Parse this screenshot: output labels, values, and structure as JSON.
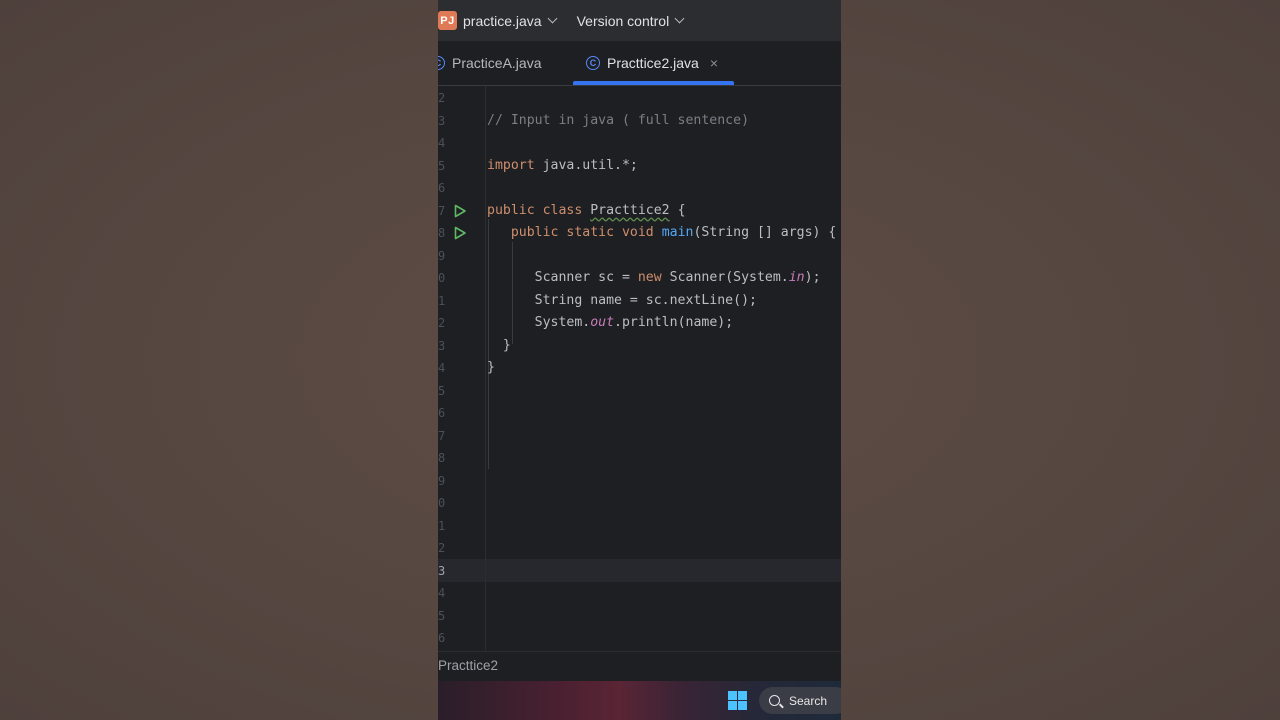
{
  "titlebar": {
    "project_badge": "PJ",
    "project_name": "practice.java",
    "vcs_label": "Version control"
  },
  "tabs": [
    {
      "icon": "C",
      "label": "PracticeA.java",
      "active": false
    },
    {
      "icon": "C",
      "label": "Practtice2.java",
      "active": true,
      "close": "×"
    }
  ],
  "editor": {
    "current_line": "3",
    "lines": [
      {
        "num": "2",
        "tokens": []
      },
      {
        "num": "3",
        "tokens": [
          {
            "t": "cm",
            "v": "// Input in java ( full sentence)"
          }
        ]
      },
      {
        "num": "4",
        "tokens": []
      },
      {
        "num": "5",
        "tokens": [
          {
            "t": "kw",
            "v": "import"
          },
          {
            "t": "pl",
            "v": " java.util.*;"
          }
        ]
      },
      {
        "num": "6",
        "tokens": []
      },
      {
        "num": "7",
        "run": true,
        "tokens": [
          {
            "t": "kw",
            "v": "public class "
          },
          {
            "t": "wavy",
            "v": "Practtice2"
          },
          {
            "t": "pl",
            "v": " {"
          }
        ]
      },
      {
        "num": "8",
        "run": true,
        "tokens": [
          {
            "t": "pl",
            "v": "   "
          },
          {
            "t": "kw",
            "v": "public static void "
          },
          {
            "t": "fn",
            "v": "main"
          },
          {
            "t": "pl",
            "v": "(String [] args) {"
          }
        ]
      },
      {
        "num": "9",
        "tokens": []
      },
      {
        "num": "0",
        "tokens": [
          {
            "t": "pl",
            "v": "      Scanner sc = "
          },
          {
            "t": "kw",
            "v": "new"
          },
          {
            "t": "pl",
            "v": " Scanner(System."
          },
          {
            "t": "st",
            "v": "in"
          },
          {
            "t": "pl",
            "v": ");"
          }
        ]
      },
      {
        "num": "1",
        "tokens": [
          {
            "t": "pl",
            "v": "      String name = sc.nextLine();"
          }
        ]
      },
      {
        "num": "2",
        "tokens": [
          {
            "t": "pl",
            "v": "      System."
          },
          {
            "t": "st",
            "v": "out"
          },
          {
            "t": "pl",
            "v": ".println(name);"
          }
        ]
      },
      {
        "num": "3",
        "tokens": [
          {
            "t": "pl",
            "v": "  }"
          }
        ]
      },
      {
        "num": "4",
        "tokens": [
          {
            "t": "pl",
            "v": "}"
          }
        ]
      },
      {
        "num": "5",
        "tokens": []
      },
      {
        "num": "6",
        "tokens": []
      },
      {
        "num": "7",
        "tokens": []
      },
      {
        "num": "8",
        "tokens": []
      },
      {
        "num": "9",
        "tokens": []
      },
      {
        "num": "0",
        "tokens": []
      },
      {
        "num": "1",
        "tokens": []
      },
      {
        "num": "2",
        "tokens": []
      },
      {
        "num": "3",
        "current": true,
        "tokens": []
      },
      {
        "num": "4",
        "tokens": []
      },
      {
        "num": "5",
        "tokens": []
      },
      {
        "num": "6",
        "tokens": []
      }
    ]
  },
  "breadcrumb": {
    "label": "Practtice2"
  },
  "taskbar": {
    "search_label": "Search"
  },
  "colors": {
    "accent": "#3574f0",
    "keyword": "#cf8e6d",
    "function": "#56a8f5",
    "static_field": "#c77dbb",
    "comment": "#7a7e85"
  }
}
